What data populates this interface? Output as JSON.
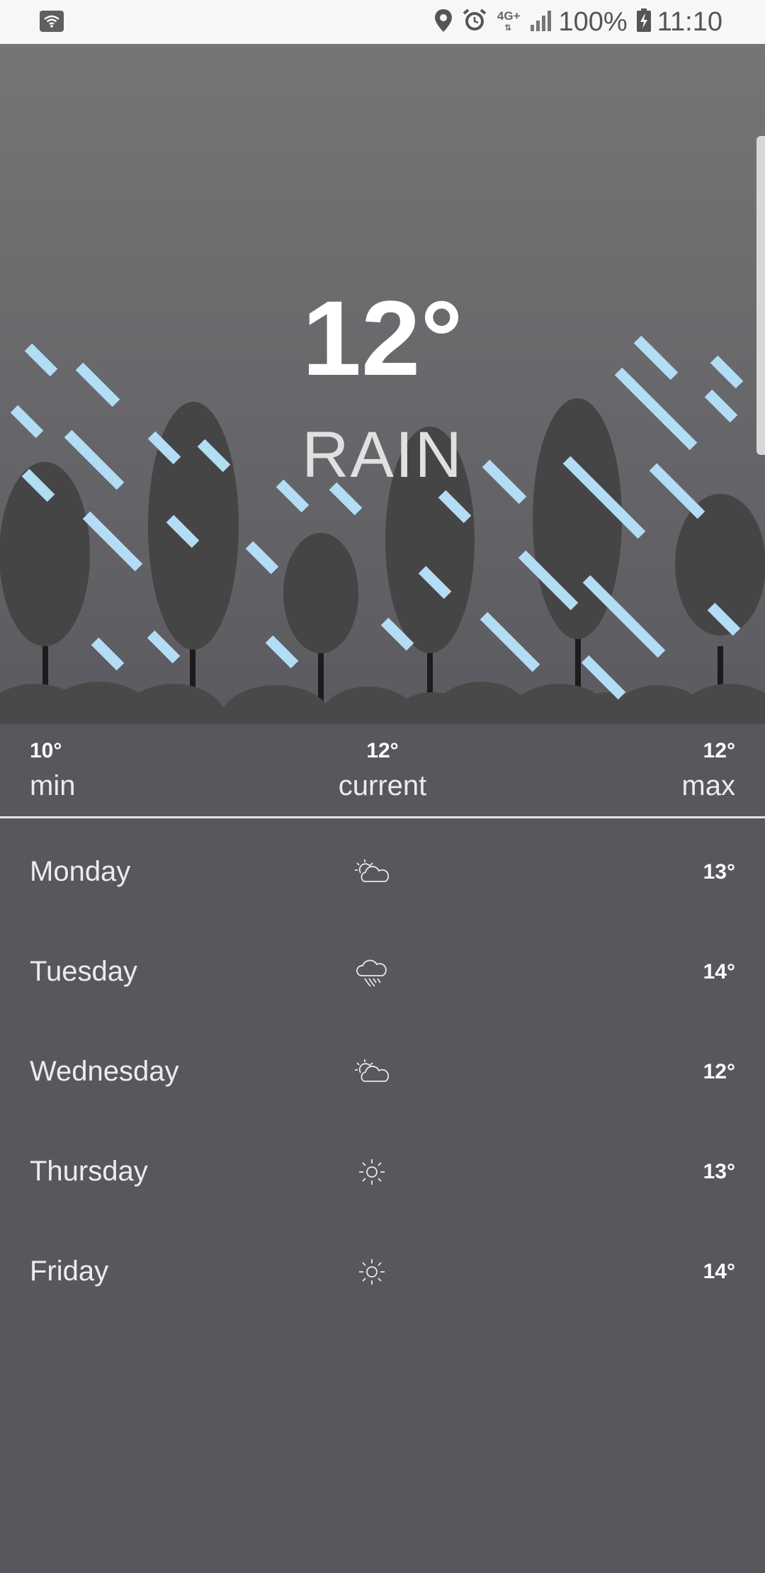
{
  "status_bar": {
    "network": "4G+",
    "battery": "100%",
    "time": "11:10",
    "icons": [
      "wifi-icon",
      "location-icon",
      "alarm-icon",
      "signal-icon",
      "battery-icon"
    ]
  },
  "current": {
    "temperature": "12°",
    "condition": "RAIN"
  },
  "summary": {
    "min": {
      "value": "10°",
      "label": "min"
    },
    "current": {
      "value": "12°",
      "label": "current"
    },
    "max": {
      "value": "12°",
      "label": "max"
    }
  },
  "forecast": [
    {
      "day": "Monday",
      "icon": "partly-cloudy-icon",
      "high": "13°"
    },
    {
      "day": "Tuesday",
      "icon": "rain-cloud-icon",
      "high": "14°"
    },
    {
      "day": "Wednesday",
      "icon": "partly-cloudy-icon",
      "high": "12°"
    },
    {
      "day": "Thursday",
      "icon": "sun-icon",
      "high": "13°"
    },
    {
      "day": "Friday",
      "icon": "sun-icon",
      "high": "14°"
    }
  ],
  "colors": {
    "rain": "#b3dcf5",
    "tree": "#454545",
    "background": "#58575e",
    "statusbar": "#f7f7f7"
  }
}
